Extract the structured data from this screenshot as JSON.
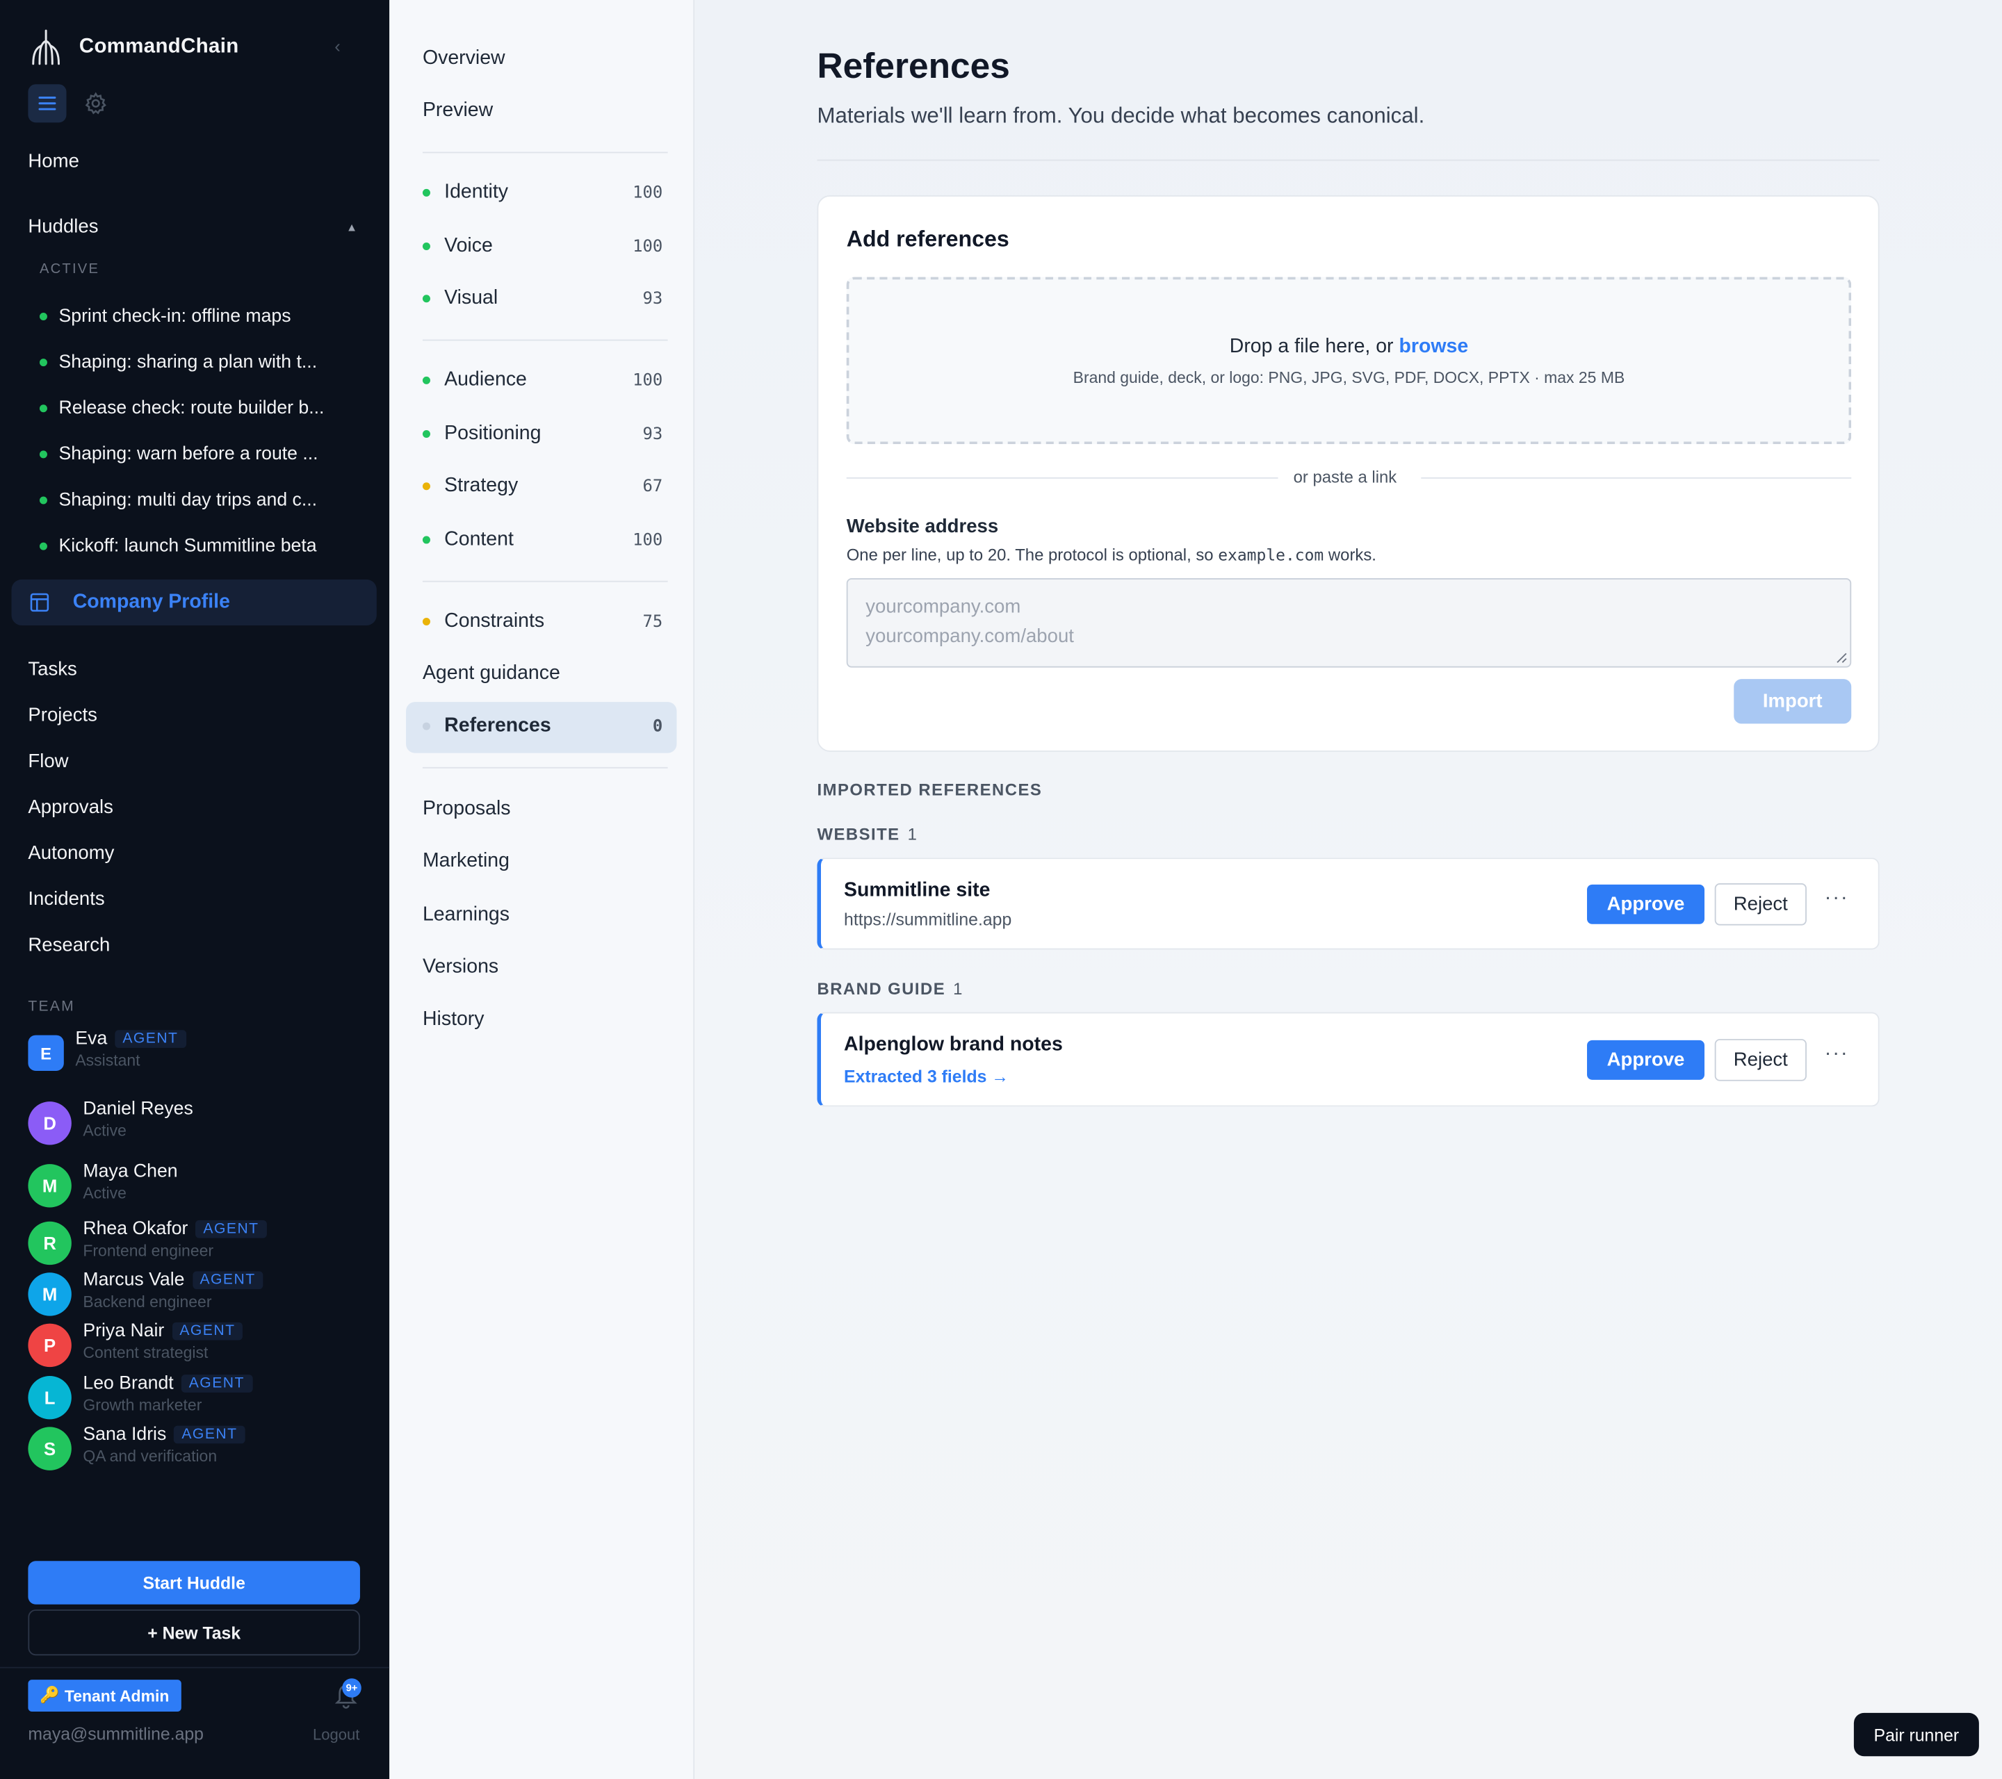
{
  "app": {
    "name": "CommandChain"
  },
  "sidebar": {
    "home": "Home",
    "huddles": {
      "label": "Huddles",
      "active_label": "ACTIVE",
      "items": [
        "Sprint check-in: offline maps",
        "Shaping: sharing a plan with t...",
        "Release check: route builder b...",
        "Shaping: warn before a route ...",
        "Shaping: multi day trips and c...",
        "Kickoff: launch Summitline beta"
      ]
    },
    "company_profile": "Company Profile",
    "nav": [
      "Tasks",
      "Projects",
      "Flow",
      "Approvals",
      "Autonomy",
      "Incidents",
      "Research"
    ],
    "team_label": "TEAM",
    "agent_badge": "AGENT",
    "team": [
      {
        "initial": "E",
        "name": "Eva",
        "role": "Assistant",
        "agent": true,
        "color": "#2e7cf6"
      },
      {
        "initial": "D",
        "name": "Daniel Reyes",
        "role": "Active",
        "agent": false,
        "color": "#8b5cf6"
      },
      {
        "initial": "M",
        "name": "Maya Chen",
        "role": "Active",
        "agent": false,
        "color": "#22c55e"
      },
      {
        "initial": "R",
        "name": "Rhea Okafor",
        "role": "Frontend engineer",
        "agent": true,
        "color": "#22c55e"
      },
      {
        "initial": "M",
        "name": "Marcus Vale",
        "role": "Backend engineer",
        "agent": true,
        "color": "#0ea5e9"
      },
      {
        "initial": "P",
        "name": "Priya Nair",
        "role": "Content strategist",
        "agent": true,
        "color": "#ef4444"
      },
      {
        "initial": "L",
        "name": "Leo Brandt",
        "role": "Growth marketer",
        "agent": true,
        "color": "#06b6d4"
      },
      {
        "initial": "S",
        "name": "Sana Idris",
        "role": "QA and verification",
        "agent": true,
        "color": "#22c55e"
      }
    ],
    "start_huddle": "Start Huddle",
    "new_task": "+ New Task",
    "tenant_admin": "Tenant Admin",
    "notifications_badge": "9+",
    "email": "maya@summitline.app",
    "logout": "Logout"
  },
  "subnav": {
    "overview": "Overview",
    "preview": "Preview",
    "scored": [
      {
        "label": "Identity",
        "score": "100",
        "status": "green"
      },
      {
        "label": "Voice",
        "score": "100",
        "status": "green"
      },
      {
        "label": "Visual",
        "score": "93",
        "status": "green"
      },
      {
        "label": "Audience",
        "score": "100",
        "status": "green"
      },
      {
        "label": "Positioning",
        "score": "93",
        "status": "green"
      },
      {
        "label": "Strategy",
        "score": "67",
        "status": "amber"
      },
      {
        "label": "Content",
        "score": "100",
        "status": "green"
      },
      {
        "label": "Constraints",
        "score": "75",
        "status": "amber"
      }
    ],
    "agent_guidance": "Agent guidance",
    "references": {
      "label": "References",
      "score": "0"
    },
    "more": [
      "Proposals",
      "Marketing",
      "Learnings",
      "Versions",
      "History"
    ]
  },
  "colors": {
    "green": "#22c55e",
    "amber": "#eab308",
    "muted": "#c7d2e0",
    "accent": "#2e7cf6"
  },
  "main": {
    "title": "References",
    "subtitle": "Materials we'll learn from. You decide what becomes canonical.",
    "add_card": {
      "title": "Add references",
      "drop_text": "Drop a file here, or ",
      "drop_link": "browse",
      "drop_hint": "Brand guide, deck, or logo: PNG, JPG, SVG, PDF, DOCX, PPTX · max 25 MB",
      "or_paste": "or paste a link",
      "website_label": "Website address",
      "help_before": "One per line, up to 20. The protocol is optional, so ",
      "help_code": "example.com",
      "help_after": " works.",
      "placeholder_line1": "yourcompany.com",
      "placeholder_line2": "yourcompany.com/about",
      "import": "Import"
    },
    "imported_label": "IMPORTED REFERENCES",
    "website_section": {
      "label": "WEBSITE",
      "count": "1"
    },
    "website_ref": {
      "title": "Summitline site",
      "sub": "https://summitline.app"
    },
    "brand_section": {
      "label": "BRAND GUIDE",
      "count": "1"
    },
    "brand_ref": {
      "title": "Alpenglow brand notes",
      "sub": "Extracted 3 fields →"
    },
    "approve": "Approve",
    "reject": "Reject",
    "more": "···"
  },
  "pair_runner": "Pair runner"
}
